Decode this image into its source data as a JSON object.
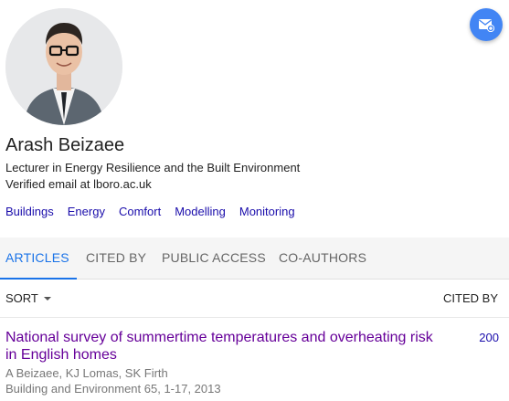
{
  "profile": {
    "name": "Arash Beizaee",
    "affiliation": "Lecturer in Energy Resilience and the Built Environment",
    "email": "Verified email at lboro.ac.uk",
    "interests": [
      "Buildings",
      "Energy",
      "Comfort",
      "Modelling",
      "Monitoring"
    ]
  },
  "tabs": [
    {
      "label": "ARTICLES",
      "active": true
    },
    {
      "label": "CITED BY",
      "active": false
    },
    {
      "label": "PUBLIC ACCESS",
      "active": false
    },
    {
      "label": "CO-AUTHORS",
      "active": false
    }
  ],
  "list_header": {
    "sort_label": "SORT",
    "cited_by_label": "CITED BY"
  },
  "articles": [
    {
      "title": "National survey of summertime temperatures and overheating risk in English homes",
      "authors": "A Beizaee, KJ Lomas, SK Firth",
      "venue": "Building and Environment 65, 1-17, 2013",
      "cited_by": "200"
    }
  ],
  "icons": {
    "follow": "email-add-icon",
    "sort": "caret-down-icon"
  },
  "colors": {
    "accent": "#1a73e8",
    "link": "#1a0dab",
    "visited_title": "#660099",
    "follow_button": "#4285f4"
  }
}
